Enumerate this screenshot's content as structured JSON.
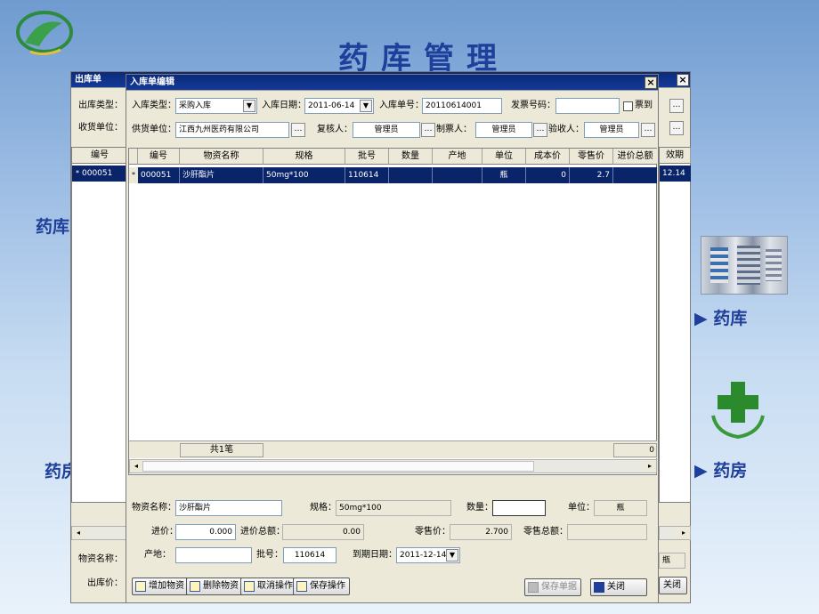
{
  "slide": {
    "title": "药库管理",
    "side_left_1": "药库",
    "side_left_2": "药房",
    "side_right_1": "药库",
    "side_right_2": "药房"
  },
  "back_window": {
    "title": "出库单",
    "close": "×",
    "labels": {
      "type": "出库类型：",
      "receiver": "收货单位：",
      "material_name": "物资名称：",
      "out_price": "出库价："
    },
    "col_code": "编号",
    "col_expiry": "效期",
    "row_code": "000051",
    "row_expiry": "12.14",
    "unit_tail": "瓶",
    "close_btn": "关闭",
    "dots": "…"
  },
  "front_window": {
    "title": "入库单编辑",
    "close": "×",
    "header": {
      "type_label": "入库类型：",
      "type_value": "采购入库",
      "date_label": "入库日期：",
      "date_value": "2011-06-14",
      "number_label": "入库单号：",
      "number_value": "20110614001",
      "invoice_label": "发票号码：",
      "invoice_value": "",
      "invoice_check_label": "票到",
      "supplier_label": "供货单位：",
      "supplier_value": "江西九州医药有限公司",
      "reviewer_label": "复核人：",
      "reviewer_value": "管理员",
      "maker_label": "制票人：",
      "maker_value": "管理员",
      "inspector_label": "验收人：",
      "inspector_value": "管理员",
      "dots": "…",
      "dropdown": "▼"
    },
    "table": {
      "columns": [
        "编号",
        "物资名称",
        "规格",
        "批号",
        "数量",
        "产地",
        "单位",
        "成本价",
        "零售价",
        "进价总额"
      ],
      "rows": [
        {
          "marker": "*",
          "cells": [
            "000051",
            "沙肝酯片",
            "50mg*100",
            "110614",
            "",
            "",
            "瓶",
            "0",
            "2.7",
            ""
          ]
        }
      ],
      "footer_count": "共1笔",
      "footer_total": "0"
    },
    "detail": {
      "name_label": "物资名称：",
      "name_value": "沙肝酯片",
      "spec_label": "规格：",
      "spec_value": "50mg*100",
      "qty_label": "数量：",
      "qty_value": "",
      "unit_label": "单位：",
      "unit_value": "瓶",
      "in_price_label": "进价：",
      "in_price_value": "0.000",
      "in_total_label": "进价总额：",
      "in_total_value": "0.00",
      "retail_label": "零售价：",
      "retail_value": "2.700",
      "retail_total_label": "零售总额：",
      "retail_total_value": "",
      "origin_label": "产地：",
      "origin_value": "",
      "batch_label": "批号：",
      "batch_value": "110614",
      "expiry_label": "到期日期：",
      "expiry_value": "2011-12-14"
    },
    "buttons": {
      "add": "增加物资",
      "delete": "删除物资",
      "cancel": "取消操作",
      "save": "保存操作",
      "save_doc": "保存单据",
      "close": "关闭"
    },
    "scroll_left": "◂",
    "scroll_right": "▸"
  },
  "colors": {
    "title": "#1f3f9a",
    "selected_row": "#0a246a",
    "window_bg": "#ece9d8",
    "titlebar_dark": "#0b2a7a"
  }
}
